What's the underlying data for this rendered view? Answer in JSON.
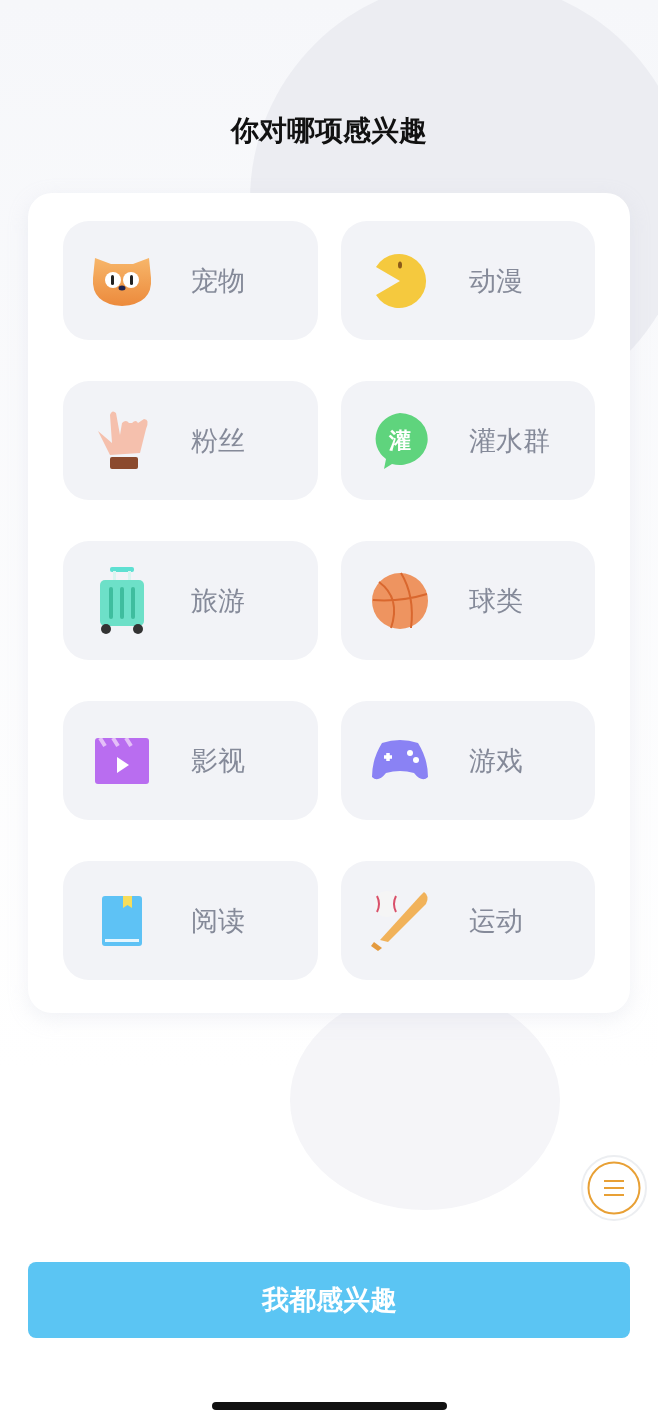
{
  "title": "你对哪项感兴趣",
  "interests": [
    {
      "kind": "cat",
      "label": "宠物"
    },
    {
      "kind": "pacman",
      "label": "动漫"
    },
    {
      "kind": "hand",
      "label": "粉丝"
    },
    {
      "kind": "bubble",
      "label": "灌水群",
      "icon_text": "灌"
    },
    {
      "kind": "suitcase",
      "label": "旅游"
    },
    {
      "kind": "basketball",
      "label": "球类"
    },
    {
      "kind": "clapper",
      "label": "影视"
    },
    {
      "kind": "gamepad",
      "label": "游戏"
    },
    {
      "kind": "book",
      "label": "阅读"
    },
    {
      "kind": "baseball",
      "label": "运动"
    }
  ],
  "all_button": "我都感兴趣"
}
